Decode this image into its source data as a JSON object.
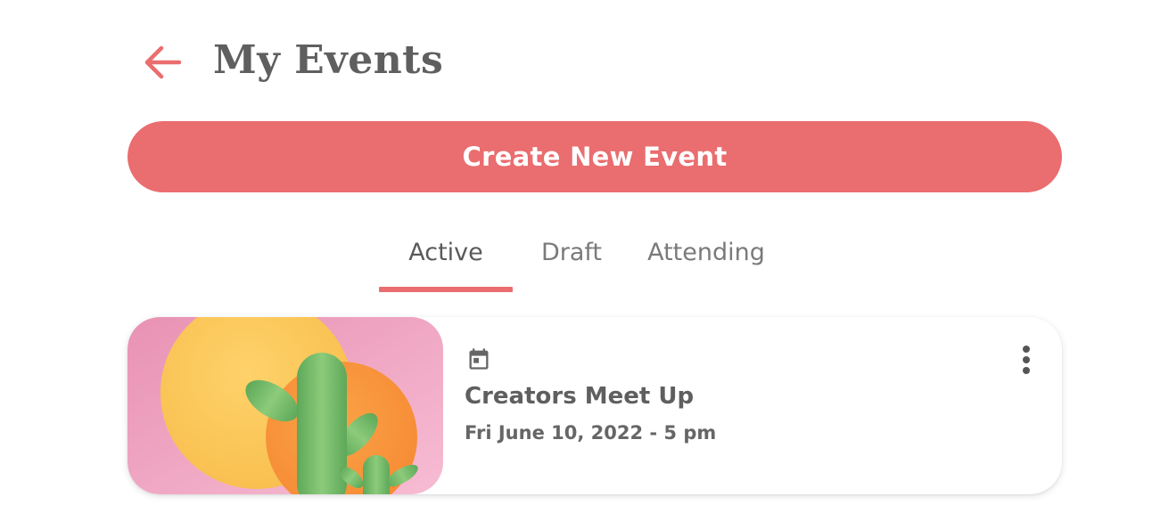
{
  "header": {
    "title": "My Events",
    "back_icon": "arrow-left-icon",
    "accent_color": "#ea6d6f"
  },
  "create_button": {
    "label": "Create New Event"
  },
  "tabs": [
    {
      "label": "Active",
      "selected": true
    },
    {
      "label": "Draft",
      "selected": false
    },
    {
      "label": "Attending",
      "selected": false
    }
  ],
  "events": [
    {
      "name": "Creators Meet Up",
      "date": "Fri June 10, 2022 - 5 pm",
      "date_icon": "calendar-icon",
      "menu_icon": "more-vertical-icon"
    }
  ]
}
